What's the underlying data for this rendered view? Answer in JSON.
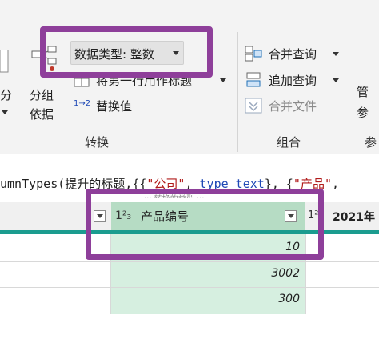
{
  "ribbon": {
    "left_partial": "分",
    "group_by": {
      "line1": "分组",
      "line2": "依据"
    },
    "data_type": {
      "label": "数据类型: 整数"
    },
    "use_first_row": {
      "label": "将第一行用作标题"
    },
    "replace_values": {
      "label": "替换值",
      "icon_text": "1→2"
    },
    "transform_group": "转换",
    "merge_queries": {
      "label": "合并查询"
    },
    "append_queries": {
      "label": "追加查询"
    },
    "combine_files": {
      "label": "合并文件"
    },
    "combine_group": "组合",
    "manage_params": {
      "line1": "管",
      "line2": "参"
    },
    "params_group": "参"
  },
  "formula": {
    "tokens": [
      {
        "text": "umnTypes(",
        "kind": "plain"
      },
      {
        "text": "提升的标题",
        "kind": "plain"
      },
      {
        "text": ",{{",
        "kind": "plain"
      },
      {
        "text": "\"公司\"",
        "kind": "str"
      },
      {
        "text": ", ",
        "kind": "plain"
      },
      {
        "text": "type text",
        "kind": "kw"
      },
      {
        "text": "}, {",
        "kind": "plain"
      },
      {
        "text": "\"产品\"",
        "kind": "str"
      },
      {
        "text": ",",
        "kind": "plain"
      }
    ],
    "under_text": "··· 转换的类型 ···"
  },
  "grid": {
    "columns": [
      {
        "type_icon": "1²₃",
        "name": "产品编号"
      },
      {
        "type_icon": "1²",
        "name": "2021年"
      }
    ],
    "rows": [
      {
        "product_id": "10"
      },
      {
        "product_id": "3002"
      },
      {
        "product_id": "300"
      }
    ]
  },
  "colors": {
    "accent_teal": "#1b9c8f",
    "selected_header": "#b6dcc4",
    "selected_cells": "#d6efe0",
    "highlight_box": "#8e3f9a",
    "string_literal": "#b11b1b",
    "keyword": "#1f49b6"
  },
  "icons": {
    "group_by": "group-by-icon",
    "data_type": "data-type-icon",
    "first_row_header": "first-row-header-icon",
    "replace_values": "replace-values-icon",
    "merge_queries": "merge-queries-icon",
    "append_queries": "append-queries-icon",
    "combine_files": "combine-files-icon",
    "dropdown": "chevron-down-icon"
  }
}
